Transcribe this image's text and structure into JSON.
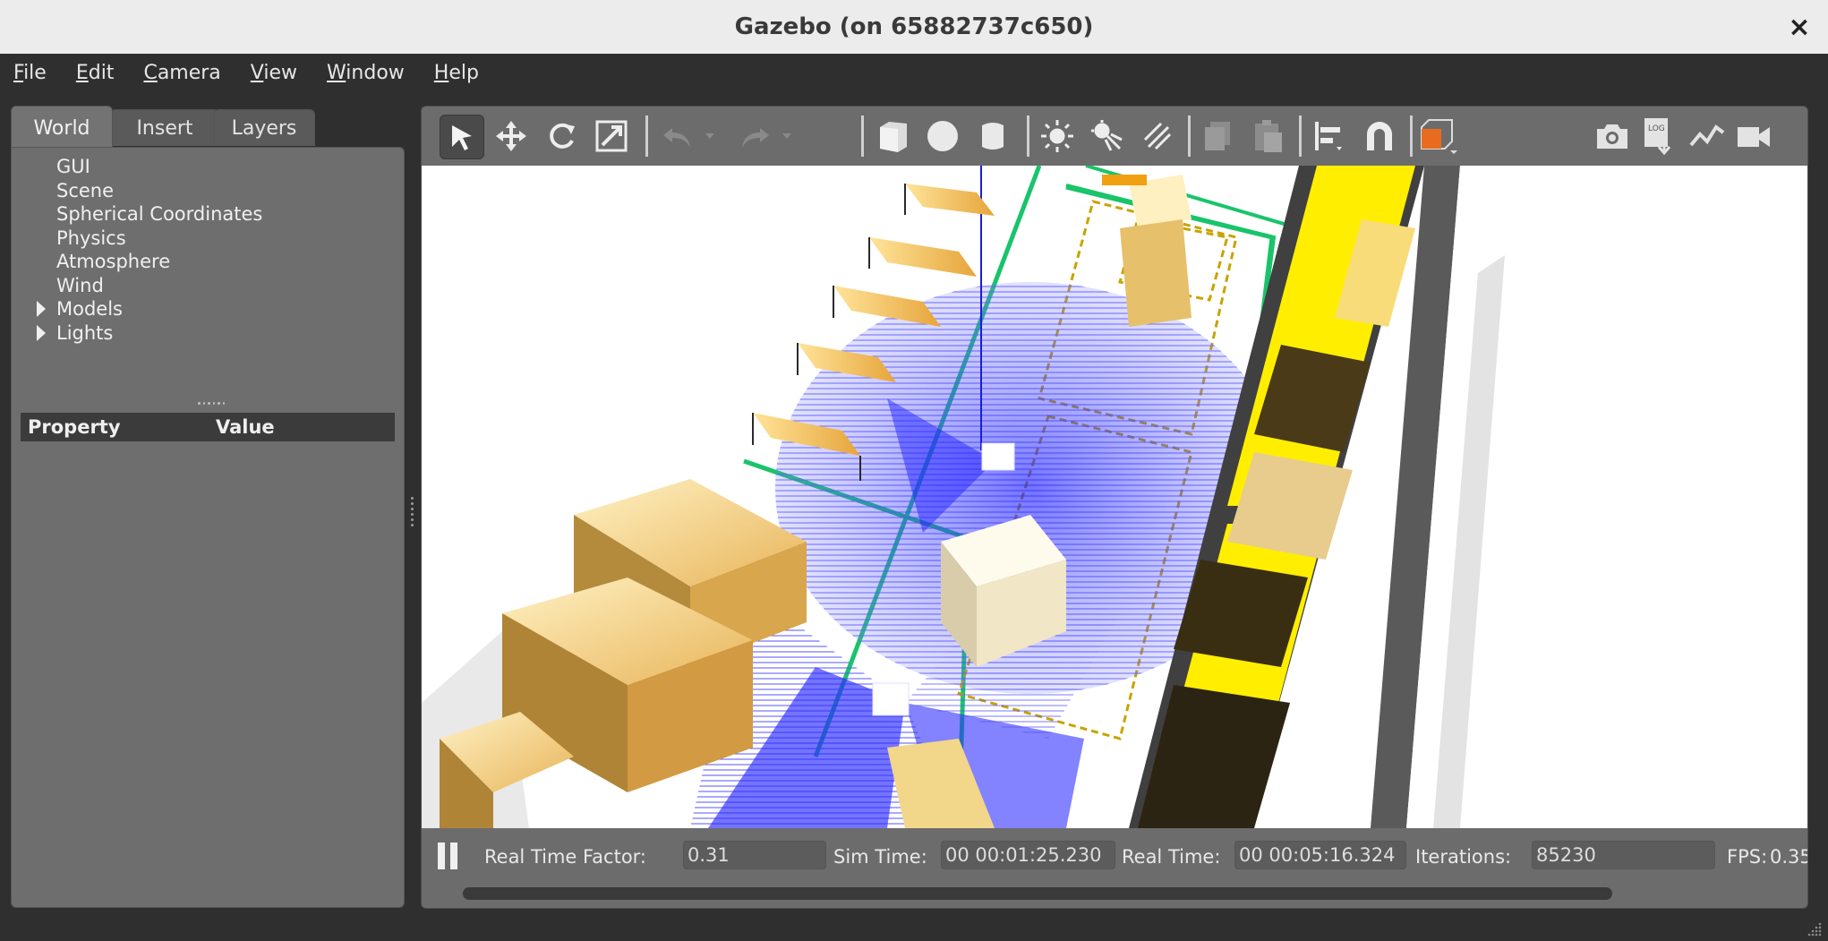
{
  "window": {
    "title": "Gazebo (on 65882737c650)",
    "close_glyph": "×"
  },
  "menu": [
    {
      "acc": "F",
      "rest": "ile"
    },
    {
      "acc": "E",
      "rest": "dit"
    },
    {
      "acc": "C",
      "rest": "amera"
    },
    {
      "acc": "V",
      "rest": "iew"
    },
    {
      "acc": "W",
      "rest": "indow"
    },
    {
      "acc": "H",
      "rest": "elp"
    }
  ],
  "left_panel": {
    "tabs": [
      "World",
      "Insert",
      "Layers"
    ],
    "active_tab": "World",
    "tree": [
      "GUI",
      "Scene",
      "Spherical Coordinates",
      "Physics",
      "Atmosphere",
      "Wind",
      "Models",
      "Lights"
    ],
    "property_header": {
      "property": "Property",
      "value": "Value"
    }
  },
  "toolbar": {
    "icons": [
      "select-arrow-icon",
      "translate-icon",
      "rotate-icon",
      "scale-icon",
      "undo-icon",
      "redo-icon",
      "box-icon",
      "sphere-icon",
      "cylinder-icon",
      "point-light-icon",
      "spot-light-icon",
      "directional-light-icon",
      "copy-icon",
      "paste-icon",
      "align-icon",
      "snap-magnet-icon",
      "view-angle-icon",
      "screenshot-icon",
      "log-icon",
      "plot-icon",
      "record-video-icon"
    ]
  },
  "status": {
    "real_time_factor_label": "Real Time Factor:",
    "real_time_factor": "0.31",
    "sim_time_label": "Sim Time:",
    "sim_time": "00 00:01:25.230",
    "real_time_label": "Real Time:",
    "real_time": "00 00:05:16.324",
    "iterations_label": "Iterations:",
    "iterations": "85230",
    "fps_label": "FPS:",
    "fps": "0.35"
  },
  "colors": {
    "laser": "#2d2df5",
    "lane_green": "#19c46a",
    "box": "#f4d98a",
    "shelf_yellow": "#ffee00"
  }
}
